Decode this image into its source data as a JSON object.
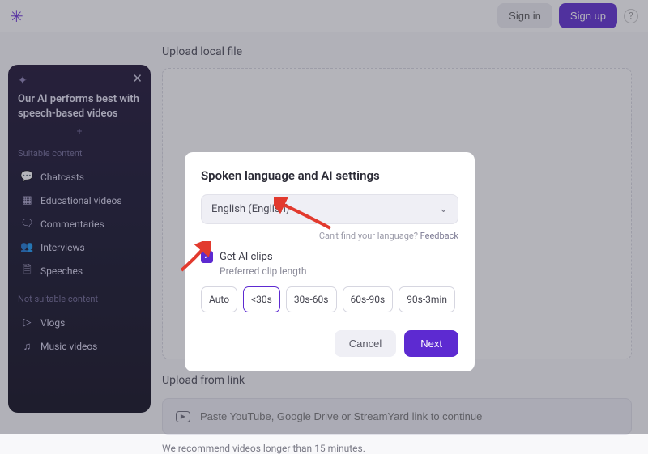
{
  "header": {
    "signin": "Sign in",
    "signup": "Sign up"
  },
  "main": {
    "upload_local_label": "Upload local file",
    "upload_link_label": "Upload from link",
    "link_placeholder": "Paste YouTube, Google Drive or StreamYard link to continue",
    "recommendation": "We recommend videos longer than 15 minutes."
  },
  "sidebar": {
    "headline": "Our AI performs best with speech-based videos",
    "suitable_label": "Suitable content",
    "suitable": [
      {
        "icon": "chat-icon",
        "label": "Chatcasts"
      },
      {
        "icon": "play-grid-icon",
        "label": "Educational videos"
      },
      {
        "icon": "comment-icon",
        "label": "Commentaries"
      },
      {
        "icon": "people-icon",
        "label": "Interviews"
      },
      {
        "icon": "doc-icon",
        "label": "Speeches"
      }
    ],
    "not_suitable_label": "Not suitable content",
    "not_suitable": [
      {
        "icon": "play-circle-icon",
        "label": "Vlogs"
      },
      {
        "icon": "music-icon",
        "label": "Music videos"
      }
    ]
  },
  "modal": {
    "title": "Spoken language and AI settings",
    "language": "English (English)",
    "cant_find": "Can't find your language?",
    "feedback": "Feedback",
    "get_clips": "Get AI clips",
    "pref_label": "Preferred clip length",
    "chips": [
      "Auto",
      "<30s",
      "30s-60s",
      "60s-90s",
      "90s-3min"
    ],
    "selected_chip_index": 1,
    "cancel": "Cancel",
    "next": "Next"
  }
}
